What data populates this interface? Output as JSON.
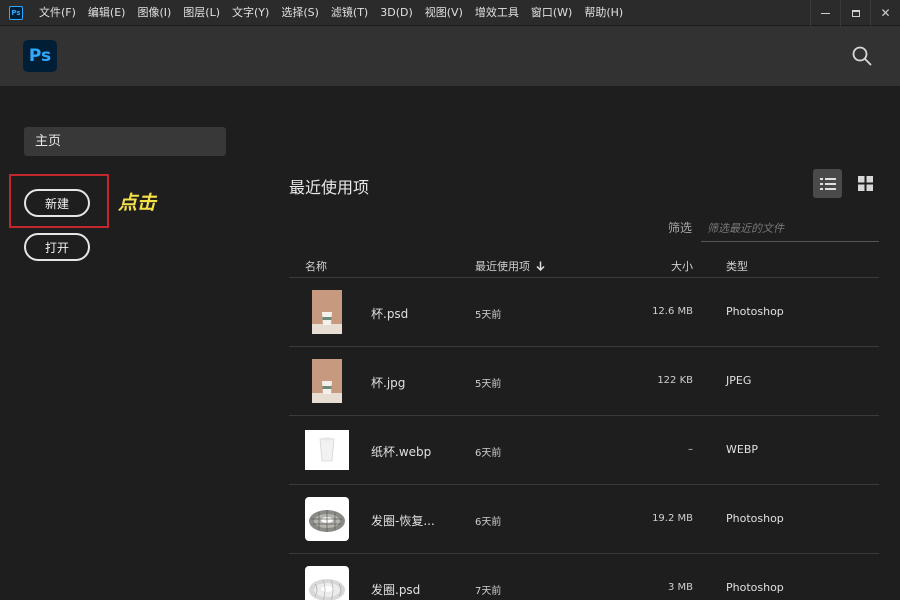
{
  "menubar": {
    "logo": "Ps",
    "items": [
      "文件(F)",
      "编辑(E)",
      "图像(I)",
      "图层(L)",
      "文字(Y)",
      "选择(S)",
      "滤镜(T)",
      "3D(D)",
      "视图(V)",
      "增效工具",
      "窗口(W)",
      "帮助(H)"
    ],
    "close_glyph": "✕"
  },
  "header": {
    "logo": "Ps"
  },
  "sidebar": {
    "home_label": "主页",
    "new_label": "新建",
    "open_label": "打开",
    "annotation": "点击",
    "highlight_color": "#c1272d",
    "annotation_color": "#f5e04a"
  },
  "main": {
    "title": "最近使用项",
    "filter_label": "筛选",
    "filter_placeholder": "筛选最近的文件",
    "columns": {
      "name": "名称",
      "recent": "最近使用项",
      "size": "大小",
      "type": "类型"
    },
    "files": [
      {
        "name": "杯.psd",
        "recent": "5天前",
        "size": "12.6 MB",
        "type": "Photoshop",
        "thumb": "cup-brown"
      },
      {
        "name": "杯.jpg",
        "recent": "5天前",
        "size": "122 KB",
        "type": "JPEG",
        "thumb": "cup-brown"
      },
      {
        "name": "纸杯.webp",
        "recent": "6天前",
        "size": "–",
        "type": "WEBP",
        "thumb": "cup-white"
      },
      {
        "name": "发圈-恢复...",
        "recent": "6天前",
        "size": "19.2 MB",
        "type": "Photoshop",
        "thumb": "scrunchie-plaid"
      },
      {
        "name": "发圈.psd",
        "recent": "7天前",
        "size": "3 MB",
        "type": "Photoshop",
        "thumb": "scrunchie-white"
      }
    ]
  },
  "colors": {
    "accent": "#31a8ff",
    "logo_bg": "#001e36",
    "panel": "#1e1e1e",
    "header": "#323232"
  }
}
